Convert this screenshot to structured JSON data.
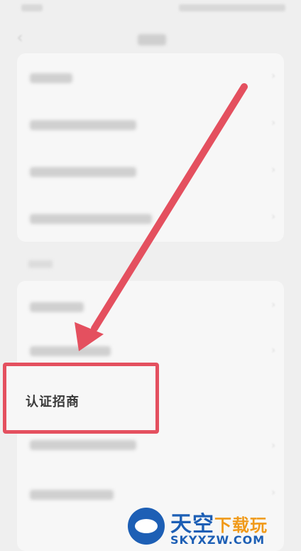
{
  "highlight": {
    "label": "认证招商"
  },
  "watermark": {
    "name_blue": "天空",
    "name_orange": "下载玩",
    "url": "SKYXZW.COM"
  },
  "colors": {
    "annotation": "#e4505f",
    "watermark_blue": "#1d5fb5",
    "watermark_orange": "#f09a1a"
  },
  "icons": {
    "back": "back-chevron-icon",
    "row_chevron": "chevron-right-icon"
  }
}
